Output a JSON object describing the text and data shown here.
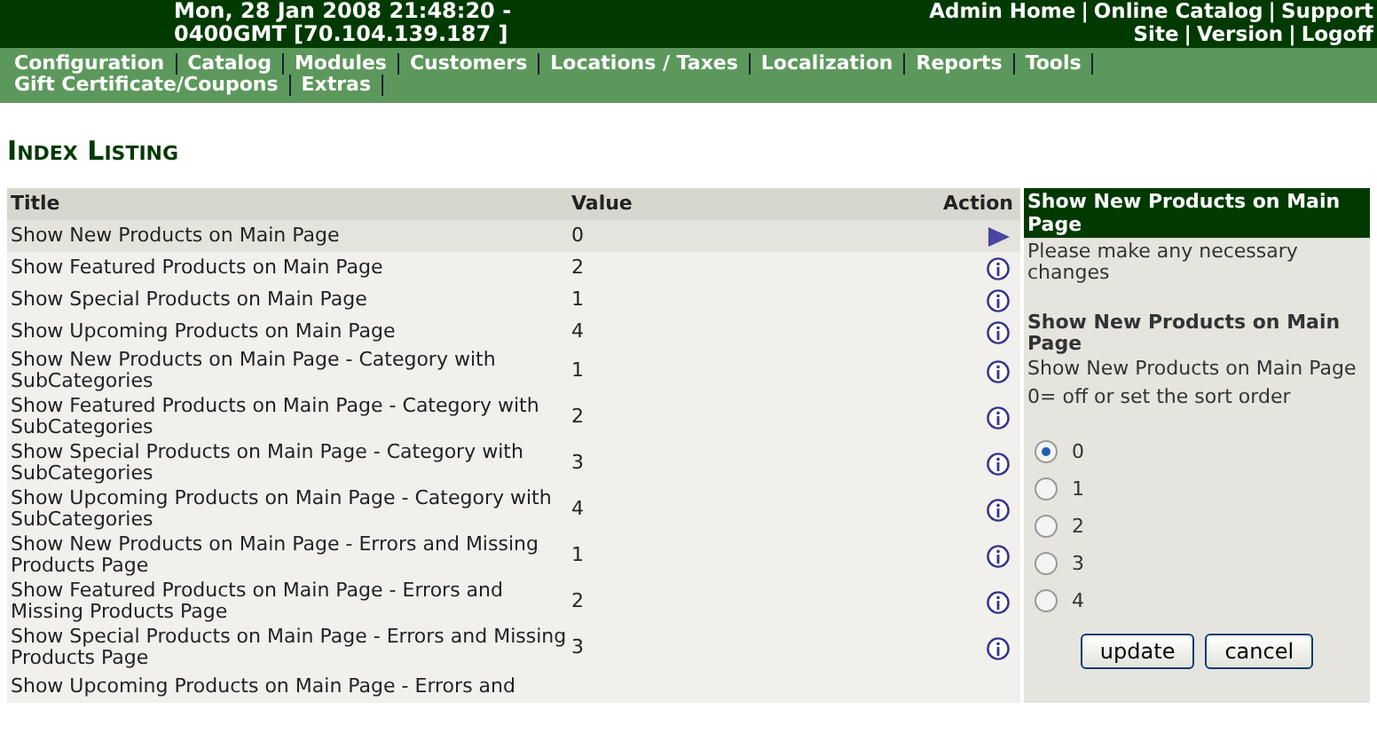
{
  "header": {
    "datetime": "Mon, 28 Jan 2008 21:48:20 - 0400GMT [70.104.139.187 ]",
    "separator": "|",
    "link_lines": [
      [
        "Admin Home",
        "Online Catalog",
        "Support"
      ],
      [
        "Site",
        "Version",
        "Logoff"
      ]
    ]
  },
  "nav": [
    "Configuration",
    "Catalog",
    "Modules",
    "Customers",
    "Locations / Taxes",
    "Localization",
    "Reports",
    "Tools",
    "Gift Certificate/Coupons",
    "Extras"
  ],
  "page_title": "Index Listing",
  "table": {
    "columns": [
      "Title",
      "Value",
      "Action"
    ],
    "rows": [
      {
        "title": "Show New Products on Main Page",
        "value": "0",
        "selected": true
      },
      {
        "title": "Show Featured Products on Main Page",
        "value": "2",
        "selected": false
      },
      {
        "title": "Show Special Products on Main Page",
        "value": "1",
        "selected": false
      },
      {
        "title": "Show Upcoming Products on Main Page",
        "value": "4",
        "selected": false
      },
      {
        "title": "Show New Products on Main Page - Category with SubCategories",
        "value": "1",
        "selected": false
      },
      {
        "title": "Show Featured Products on Main Page - Category with SubCategories",
        "value": "2",
        "selected": false
      },
      {
        "title": "Show Special Products on Main Page - Category with SubCategories",
        "value": "3",
        "selected": false
      },
      {
        "title": "Show Upcoming Products on Main Page - Category with SubCategories",
        "value": "4",
        "selected": false
      },
      {
        "title": "Show New Products on Main Page - Errors and Missing Products Page",
        "value": "1",
        "selected": false
      },
      {
        "title": "Show Featured Products on Main Page - Errors and Missing Products Page",
        "value": "2",
        "selected": false
      },
      {
        "title": "Show Special Products on Main Page - Errors and Missing Products Page",
        "value": "3",
        "selected": false
      },
      {
        "title": "Show Upcoming Products on Main Page - Errors and",
        "value": "",
        "selected": false
      }
    ]
  },
  "panel": {
    "title": "Show New Products on Main Page",
    "intro": "Please make any necessary changes",
    "setting_title": "Show New Products on Main Page",
    "setting_description": "Show New Products on Main Page",
    "setting_hint": "0= off or set the sort order",
    "options": [
      {
        "label": "0",
        "selected": true
      },
      {
        "label": "1",
        "selected": false
      },
      {
        "label": "2",
        "selected": false
      },
      {
        "label": "3",
        "selected": false
      },
      {
        "label": "4",
        "selected": false
      }
    ],
    "buttons": [
      "update",
      "cancel"
    ]
  }
}
